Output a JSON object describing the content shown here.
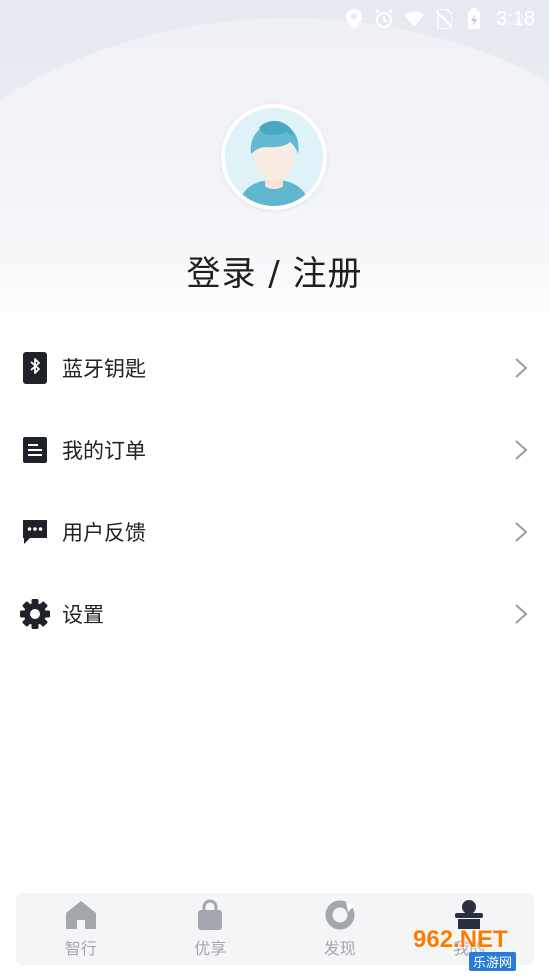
{
  "status_bar": {
    "time": "3:18",
    "icons": [
      "location-icon",
      "alarm-icon",
      "wifi-icon",
      "no-sim-icon",
      "battery-charging-icon"
    ]
  },
  "profile": {
    "avatar_icon": "user-avatar-icon",
    "login_label": "登录 / 注册"
  },
  "menu": {
    "items": [
      {
        "label": "蓝牙钥匙",
        "icon": "bluetooth-icon"
      },
      {
        "label": "我的订单",
        "icon": "order-list-icon"
      },
      {
        "label": "用户反馈",
        "icon": "feedback-chat-icon"
      },
      {
        "label": "设置",
        "icon": "gear-icon"
      }
    ]
  },
  "tab_bar": {
    "tabs": [
      {
        "label": "智行",
        "icon": "home-icon"
      },
      {
        "label": "优享",
        "icon": "shopping-bag-icon"
      },
      {
        "label": "发现",
        "icon": "discover-icon"
      },
      {
        "label": "我的",
        "icon": "profile-icon"
      }
    ],
    "colors": {
      "inactive": "#a3a6ad",
      "active": "#2b3040"
    }
  },
  "watermark": {
    "brand": "962.NET",
    "sub": "乐游网"
  }
}
